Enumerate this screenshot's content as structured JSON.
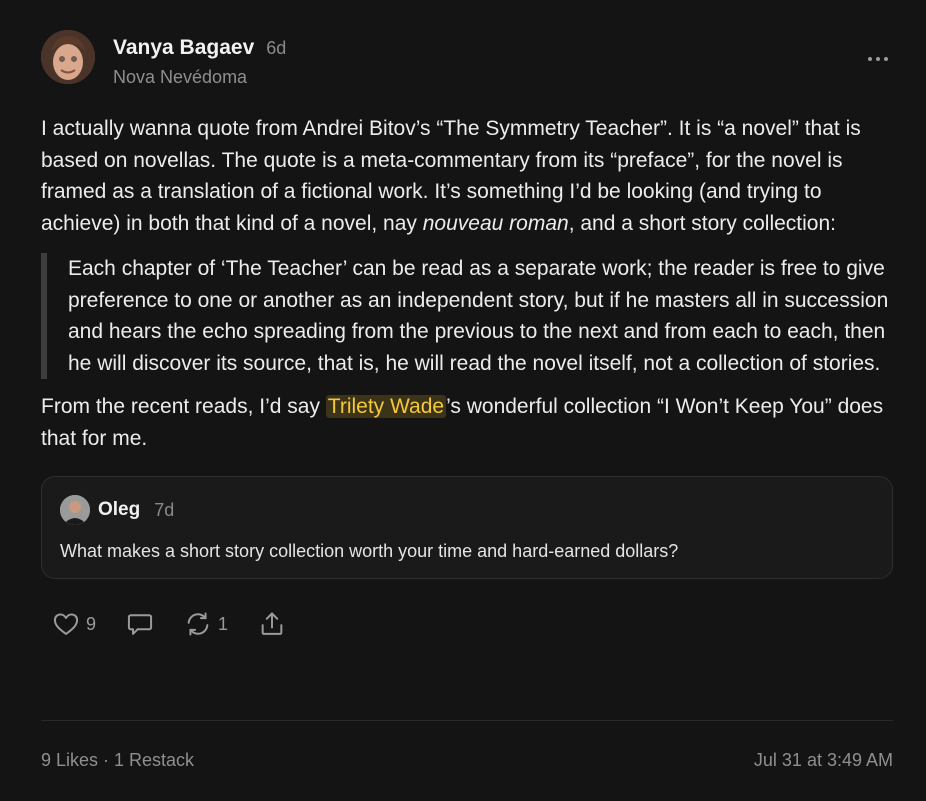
{
  "post": {
    "author": "Vanya Bagaev",
    "age": "6d",
    "publication": "Nova Nevédoma",
    "paragraph1_a": "I actually wanna quote from Andrei Bitov’s “The Symmetry Teacher”. It is “a novel” that is based on novellas. The quote is a meta-commentary from its “preface”, for the novel is framed as a translation of a fictional work. It’s something I’d be looking (and trying to achieve) in both that kind of a novel, nay ",
    "paragraph1_italic": "nouveau roman",
    "paragraph1_b": ", and a short story collection:",
    "quote": "Each chapter of ‘The Teacher’ can be read as a separate work; the reader is free to give preference to one or another as an independent story, but if he masters all in succession and hears the echo spreading from the previous to the next and from each to each, then he will discover its source, that is, he will read the novel itself, not a collection of stories.",
    "paragraph2_a": "From the recent reads, I’d say ",
    "mention": "Trilety Wade",
    "paragraph2_b": "’s wonderful collection “I Won’t Keep You” does that for me."
  },
  "quoted_note": {
    "author": "Oleg",
    "age": "7d",
    "text": "What makes a short story collection worth your time and hard-earned dollars?"
  },
  "actions": {
    "like_count": "9",
    "restack_count": "1"
  },
  "footer": {
    "stats": "9 Likes · 1 Restack",
    "timestamp": "Jul 31 at 3:49 AM"
  },
  "icons": {
    "like": "heart-icon",
    "comment": "comment-bubble-icon",
    "restack": "restack-icon",
    "share": "share-icon",
    "more": "more-dots-icon"
  },
  "colors": {
    "background": "#141414",
    "mention_text": "#f5c83b",
    "mention_bg": "#3b3418"
  }
}
